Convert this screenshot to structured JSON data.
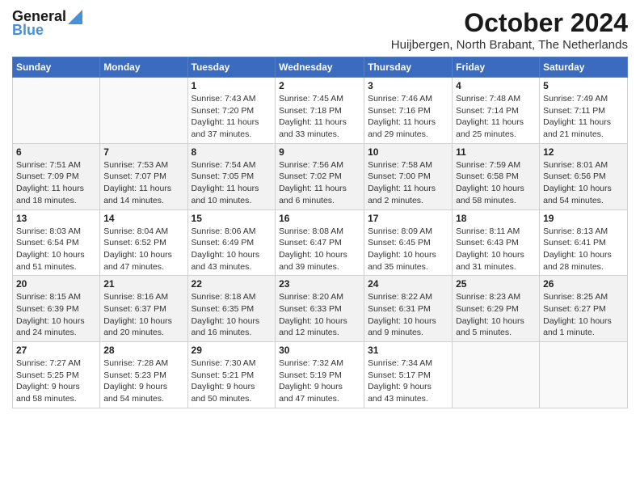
{
  "logo": {
    "general": "General",
    "blue": "Blue"
  },
  "title": "October 2024",
  "subtitle": "Huijbergen, North Brabant, The Netherlands",
  "weekdays": [
    "Sunday",
    "Monday",
    "Tuesday",
    "Wednesday",
    "Thursday",
    "Friday",
    "Saturday"
  ],
  "weeks": [
    [
      {
        "day": "",
        "sunrise": "",
        "sunset": "",
        "daylight": ""
      },
      {
        "day": "",
        "sunrise": "",
        "sunset": "",
        "daylight": ""
      },
      {
        "day": "1",
        "sunrise": "Sunrise: 7:43 AM",
        "sunset": "Sunset: 7:20 PM",
        "daylight": "Daylight: 11 hours and 37 minutes."
      },
      {
        "day": "2",
        "sunrise": "Sunrise: 7:45 AM",
        "sunset": "Sunset: 7:18 PM",
        "daylight": "Daylight: 11 hours and 33 minutes."
      },
      {
        "day": "3",
        "sunrise": "Sunrise: 7:46 AM",
        "sunset": "Sunset: 7:16 PM",
        "daylight": "Daylight: 11 hours and 29 minutes."
      },
      {
        "day": "4",
        "sunrise": "Sunrise: 7:48 AM",
        "sunset": "Sunset: 7:14 PM",
        "daylight": "Daylight: 11 hours and 25 minutes."
      },
      {
        "day": "5",
        "sunrise": "Sunrise: 7:49 AM",
        "sunset": "Sunset: 7:11 PM",
        "daylight": "Daylight: 11 hours and 21 minutes."
      }
    ],
    [
      {
        "day": "6",
        "sunrise": "Sunrise: 7:51 AM",
        "sunset": "Sunset: 7:09 PM",
        "daylight": "Daylight: 11 hours and 18 minutes."
      },
      {
        "day": "7",
        "sunrise": "Sunrise: 7:53 AM",
        "sunset": "Sunset: 7:07 PM",
        "daylight": "Daylight: 11 hours and 14 minutes."
      },
      {
        "day": "8",
        "sunrise": "Sunrise: 7:54 AM",
        "sunset": "Sunset: 7:05 PM",
        "daylight": "Daylight: 11 hours and 10 minutes."
      },
      {
        "day": "9",
        "sunrise": "Sunrise: 7:56 AM",
        "sunset": "Sunset: 7:02 PM",
        "daylight": "Daylight: 11 hours and 6 minutes."
      },
      {
        "day": "10",
        "sunrise": "Sunrise: 7:58 AM",
        "sunset": "Sunset: 7:00 PM",
        "daylight": "Daylight: 11 hours and 2 minutes."
      },
      {
        "day": "11",
        "sunrise": "Sunrise: 7:59 AM",
        "sunset": "Sunset: 6:58 PM",
        "daylight": "Daylight: 10 hours and 58 minutes."
      },
      {
        "day": "12",
        "sunrise": "Sunrise: 8:01 AM",
        "sunset": "Sunset: 6:56 PM",
        "daylight": "Daylight: 10 hours and 54 minutes."
      }
    ],
    [
      {
        "day": "13",
        "sunrise": "Sunrise: 8:03 AM",
        "sunset": "Sunset: 6:54 PM",
        "daylight": "Daylight: 10 hours and 51 minutes."
      },
      {
        "day": "14",
        "sunrise": "Sunrise: 8:04 AM",
        "sunset": "Sunset: 6:52 PM",
        "daylight": "Daylight: 10 hours and 47 minutes."
      },
      {
        "day": "15",
        "sunrise": "Sunrise: 8:06 AM",
        "sunset": "Sunset: 6:49 PM",
        "daylight": "Daylight: 10 hours and 43 minutes."
      },
      {
        "day": "16",
        "sunrise": "Sunrise: 8:08 AM",
        "sunset": "Sunset: 6:47 PM",
        "daylight": "Daylight: 10 hours and 39 minutes."
      },
      {
        "day": "17",
        "sunrise": "Sunrise: 8:09 AM",
        "sunset": "Sunset: 6:45 PM",
        "daylight": "Daylight: 10 hours and 35 minutes."
      },
      {
        "day": "18",
        "sunrise": "Sunrise: 8:11 AM",
        "sunset": "Sunset: 6:43 PM",
        "daylight": "Daylight: 10 hours and 31 minutes."
      },
      {
        "day": "19",
        "sunrise": "Sunrise: 8:13 AM",
        "sunset": "Sunset: 6:41 PM",
        "daylight": "Daylight: 10 hours and 28 minutes."
      }
    ],
    [
      {
        "day": "20",
        "sunrise": "Sunrise: 8:15 AM",
        "sunset": "Sunset: 6:39 PM",
        "daylight": "Daylight: 10 hours and 24 minutes."
      },
      {
        "day": "21",
        "sunrise": "Sunrise: 8:16 AM",
        "sunset": "Sunset: 6:37 PM",
        "daylight": "Daylight: 10 hours and 20 minutes."
      },
      {
        "day": "22",
        "sunrise": "Sunrise: 8:18 AM",
        "sunset": "Sunset: 6:35 PM",
        "daylight": "Daylight: 10 hours and 16 minutes."
      },
      {
        "day": "23",
        "sunrise": "Sunrise: 8:20 AM",
        "sunset": "Sunset: 6:33 PM",
        "daylight": "Daylight: 10 hours and 12 minutes."
      },
      {
        "day": "24",
        "sunrise": "Sunrise: 8:22 AM",
        "sunset": "Sunset: 6:31 PM",
        "daylight": "Daylight: 10 hours and 9 minutes."
      },
      {
        "day": "25",
        "sunrise": "Sunrise: 8:23 AM",
        "sunset": "Sunset: 6:29 PM",
        "daylight": "Daylight: 10 hours and 5 minutes."
      },
      {
        "day": "26",
        "sunrise": "Sunrise: 8:25 AM",
        "sunset": "Sunset: 6:27 PM",
        "daylight": "Daylight: 10 hours and 1 minute."
      }
    ],
    [
      {
        "day": "27",
        "sunrise": "Sunrise: 7:27 AM",
        "sunset": "Sunset: 5:25 PM",
        "daylight": "Daylight: 9 hours and 58 minutes."
      },
      {
        "day": "28",
        "sunrise": "Sunrise: 7:28 AM",
        "sunset": "Sunset: 5:23 PM",
        "daylight": "Daylight: 9 hours and 54 minutes."
      },
      {
        "day": "29",
        "sunrise": "Sunrise: 7:30 AM",
        "sunset": "Sunset: 5:21 PM",
        "daylight": "Daylight: 9 hours and 50 minutes."
      },
      {
        "day": "30",
        "sunrise": "Sunrise: 7:32 AM",
        "sunset": "Sunset: 5:19 PM",
        "daylight": "Daylight: 9 hours and 47 minutes."
      },
      {
        "day": "31",
        "sunrise": "Sunrise: 7:34 AM",
        "sunset": "Sunset: 5:17 PM",
        "daylight": "Daylight: 9 hours and 43 minutes."
      },
      {
        "day": "",
        "sunrise": "",
        "sunset": "",
        "daylight": ""
      },
      {
        "day": "",
        "sunrise": "",
        "sunset": "",
        "daylight": ""
      }
    ]
  ]
}
